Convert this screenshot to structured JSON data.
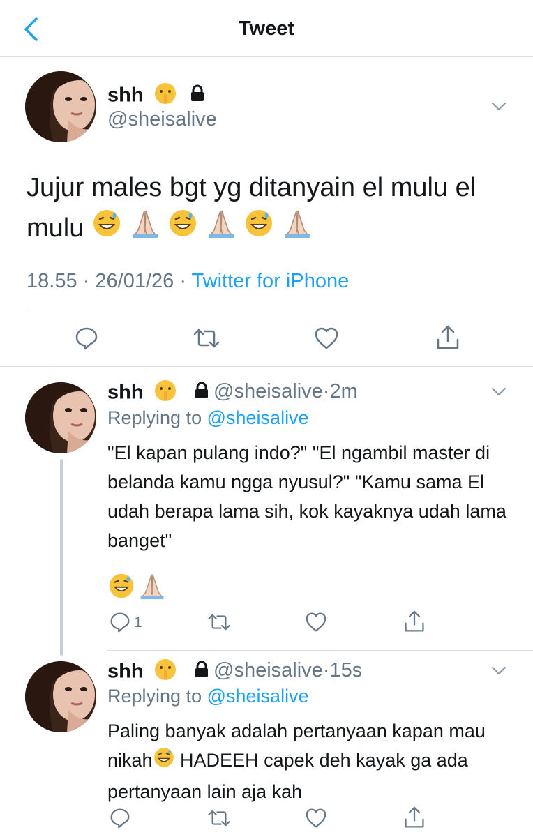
{
  "header": {
    "title": "Tweet",
    "back_icon": "chevron-left-icon"
  },
  "colors": {
    "link": "#1da1f2",
    "muted": "#657786",
    "text": "#14171a",
    "divider": "#d9dde1"
  },
  "main_tweet": {
    "name": "shh",
    "handle": "@sheisalive",
    "text": "Jujur males bgt yg ditanyain el mulu el mulu",
    "emojis": [
      "grinning-sweat",
      "folded-hands",
      "grinning-sweat",
      "folded-hands",
      "grinning-sweat",
      "folded-hands"
    ],
    "time": "18.55",
    "sep": "·",
    "date": "26/01/26",
    "source": "Twitter for iPhone"
  },
  "replies": [
    {
      "name": "shh",
      "handle": "@sheisalive",
      "sep": "·",
      "age": "2m",
      "replying_prefix": "Replying to",
      "replying_to": "@sheisalive",
      "text": "\"El kapan pulang indo?\" \"El ngambil master di belanda kamu ngga nyusul?\" \"Kamu sama El udah berapa lama sih, kok kayaknya udah lama banget\"",
      "reply_count": "1"
    },
    {
      "name": "shh",
      "handle": "@sheisalive",
      "sep": "·",
      "age": "15s",
      "replying_prefix": "Replying to",
      "replying_to": "@sheisalive",
      "text_before": "Paling banyak adalah pertanyaan kapan mau nikah",
      "text_after": " HADEEH capek deh kayak ga ada pertanyaan lain aja kah"
    }
  ]
}
